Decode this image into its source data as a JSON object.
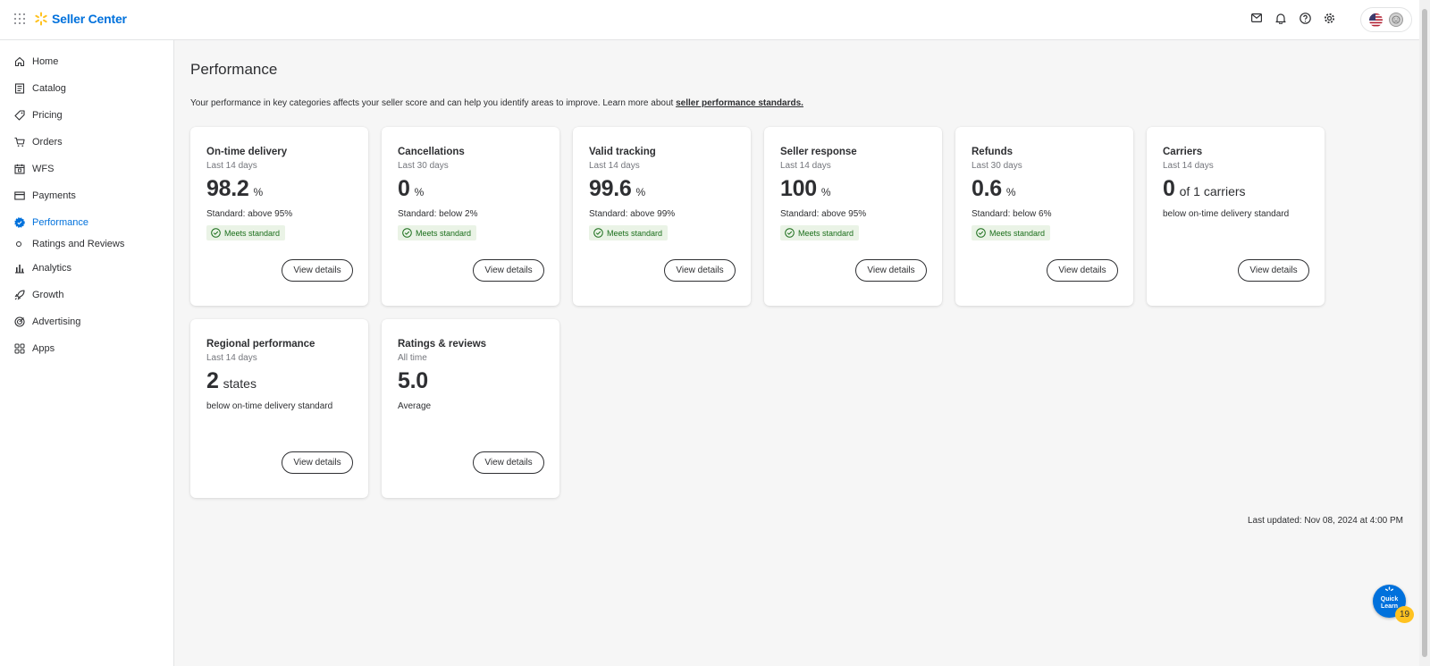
{
  "header": {
    "app_title": "Seller Center",
    "icons": [
      "apps-grid-icon",
      "walmart-spark-icon",
      "mail-icon",
      "bell-icon",
      "help-icon",
      "settings-icon",
      "us-flag-icon",
      "avatar-icon"
    ]
  },
  "sidebar": {
    "items": [
      {
        "label": "Home",
        "icon": "home-icon"
      },
      {
        "label": "Catalog",
        "icon": "catalog-icon"
      },
      {
        "label": "Pricing",
        "icon": "tag-icon"
      },
      {
        "label": "Orders",
        "icon": "cart-icon"
      },
      {
        "label": "WFS",
        "icon": "calendar-icon"
      },
      {
        "label": "Payments",
        "icon": "card-icon"
      },
      {
        "label": "Performance",
        "icon": "badge-icon",
        "active": true
      },
      {
        "label": "Ratings and Reviews",
        "icon": "dot-icon",
        "sub": true
      },
      {
        "label": "Analytics",
        "icon": "bar-chart-icon"
      },
      {
        "label": "Growth",
        "icon": "rocket-icon"
      },
      {
        "label": "Advertising",
        "icon": "target-icon"
      },
      {
        "label": "Apps",
        "icon": "apps-icon"
      }
    ]
  },
  "main": {
    "title": "Performance",
    "intro_text": "Your performance in key categories affects your seller score and can help you identify areas to improve. Learn more about ",
    "intro_link": "seller performance standards.",
    "badge_label": "Meets standard",
    "button_label": "View details",
    "last_updated": "Last updated: Nov 08, 2024 at 4:00 PM",
    "cards": [
      {
        "title": "On-time delivery",
        "period": "Last 14 days",
        "value": "98.2",
        "unit": "%",
        "standard": "Standard: above 95%",
        "badge": true
      },
      {
        "title": "Cancellations",
        "period": "Last 30 days",
        "value": "0",
        "unit": "%",
        "standard": "Standard: below 2%",
        "badge": true
      },
      {
        "title": "Valid tracking",
        "period": "Last 14 days",
        "value": "99.6",
        "unit": "%",
        "standard": "Standard: above 99%",
        "badge": true
      },
      {
        "title": "Seller response",
        "period": "Last 14 days",
        "value": "100",
        "unit": "%",
        "standard": "Standard: above 95%",
        "badge": true
      },
      {
        "title": "Refunds",
        "period": "Last 30 days",
        "value": "0.6",
        "unit": "%",
        "standard": "Standard: below 6%",
        "badge": true
      },
      {
        "title": "Carriers",
        "period": "Last 14 days",
        "value": "0",
        "unit": "of 1 carriers",
        "standard": "below on-time delivery standard",
        "badge": false
      },
      {
        "title": "Regional performance",
        "period": "Last 14 days",
        "value": "2",
        "unit": "states",
        "standard": "below on-time delivery standard",
        "badge": false
      },
      {
        "title": "Ratings & reviews",
        "period": "All time",
        "value": "5.0",
        "unit": "",
        "standard": "Average",
        "badge": false
      }
    ]
  },
  "quick_learn": {
    "label_line1": "Quick",
    "label_line2": "Learn",
    "count": "19"
  },
  "colors": {
    "brand_blue": "#0071dc",
    "spark_yellow": "#ffc220",
    "success_green": "#1a6e1a",
    "badge_bg": "#eaf3e6"
  }
}
